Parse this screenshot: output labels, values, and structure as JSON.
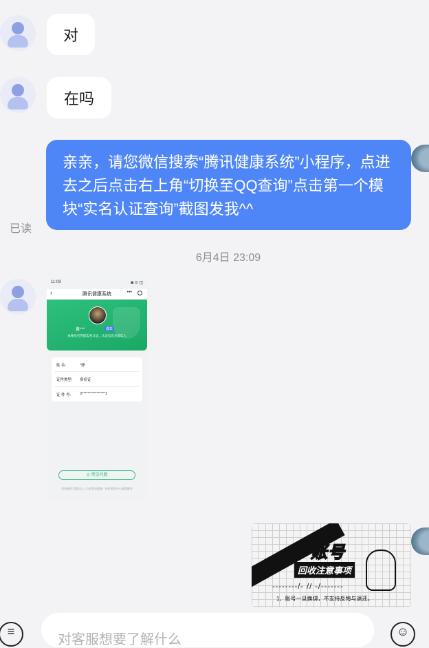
{
  "messages": {
    "m1": {
      "text": "对"
    },
    "m2": {
      "text": "在吗"
    },
    "m3": {
      "text": "亲亲，请您微信搜索“腾讯健康系统”小程序，点进去之后点击右上角“切换至QQ查询”点击第一个模块“实名认证查询”截图发我^^",
      "read_status": "已读"
    },
    "timestamp": "6月4日 23:09"
  },
  "screenshot_image": {
    "status_time": "11:09",
    "status_right": "◙ ⊙ ◫",
    "back": "‹",
    "title": "腾讯健康系统",
    "more": "•••",
    "profile_name": "黄***",
    "profile_tag": "成年",
    "profile_desc": "本账号已完成实名认证，认证信息为成年人",
    "rows": [
      {
        "label": "姓 名:",
        "value": "*婷"
      },
      {
        "label": "证件类型:",
        "value": "身份证"
      },
      {
        "label": "证 件 号:",
        "value": "3****************2"
      }
    ],
    "faq_button": "◎ 常见问题",
    "footer": "如有疑问可通过以上方式联系客服 · 前往帮助中心查看更多"
  },
  "sticker_image": {
    "title": "账号",
    "subtitle": "回收注意事项",
    "dash": "--------/-   //   -/-------",
    "note": "1、账号一旦换绑，不支持反悔与退还。"
  },
  "input_bar": {
    "placeholder": "对客服想要了解什么",
    "left_icon": "≡",
    "right_icon": "☺"
  }
}
